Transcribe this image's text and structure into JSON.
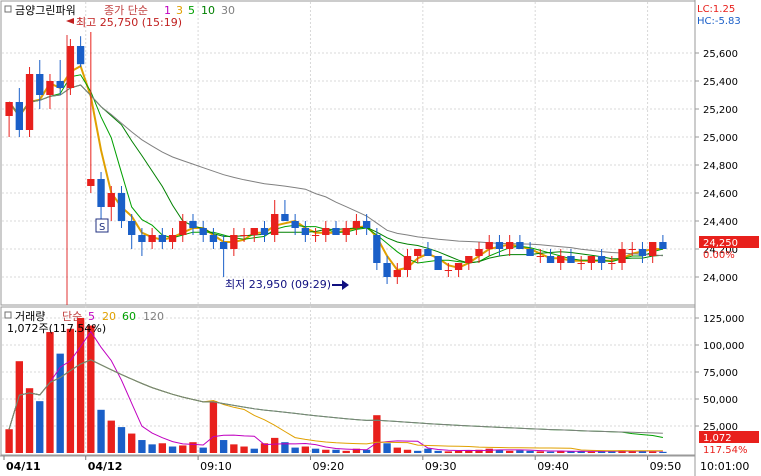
{
  "header": {
    "stock_name": "금양그린파워",
    "price_legend": "종가 단순",
    "ma_periods": [
      "1",
      "3",
      "5",
      "10",
      "30"
    ],
    "ma_colors": [
      "#c000c0",
      "#e0a000",
      "#00a000",
      "#008000",
      "#808080"
    ],
    "lc": "LC:1.25",
    "hc": "HC:-5.83"
  },
  "annotations": {
    "high": "최고 25,750 (15:19)",
    "low": "최저 23,950 (09:29)",
    "marker": "S"
  },
  "volume_header": {
    "title": "거래량",
    "ma_label": "단순",
    "ma_periods": [
      "5",
      "20",
      "60",
      "120"
    ],
    "ma_colors": [
      "#c000c0",
      "#e0a000",
      "#00a000",
      "#808080"
    ],
    "info": "1,072주(117.54%)"
  },
  "badges": {
    "price": "24,250",
    "price_pct": "0.00%",
    "volume": "1,072",
    "volume_pct": "117.54%"
  },
  "colors": {
    "up": "#e8201c",
    "down": "#1a5fc8",
    "badge": "#e8201c",
    "grid": "#d8d8d8"
  },
  "chart_data": [
    {
      "type": "candlestick",
      "x_labels": [
        "04/11",
        "04/12",
        "09:10",
        "09:20",
        "09:30",
        "09:40",
        "09:50",
        "10:01:00"
      ],
      "ylim": [
        23850,
        25750
      ],
      "yticks": [
        24000,
        24200,
        24400,
        24600,
        24800,
        25000,
        25200,
        25400,
        25600
      ],
      "ohlc": [
        [
          25150,
          25250,
          25000,
          25250
        ],
        [
          25250,
          25350,
          25000,
          25050
        ],
        [
          25050,
          25500,
          25000,
          25450
        ],
        [
          25450,
          25550,
          25200,
          25300
        ],
        [
          25300,
          25450,
          25200,
          25400
        ],
        [
          25400,
          25550,
          25300,
          25350
        ],
        [
          25350,
          25700,
          25300,
          25650
        ],
        [
          25650,
          25720,
          25500,
          25520
        ],
        [
          24650,
          25750,
          24600,
          24700
        ],
        [
          24700,
          24750,
          24400,
          24500
        ],
        [
          24500,
          24650,
          24400,
          24600
        ],
        [
          24600,
          24650,
          24350,
          24400
        ],
        [
          24400,
          24450,
          24200,
          24300
        ],
        [
          24300,
          24350,
          24150,
          24250
        ],
        [
          24250,
          24350,
          24200,
          24300
        ],
        [
          24300,
          24350,
          24200,
          24250
        ],
        [
          24250,
          24350,
          24200,
          24300
        ],
        [
          24300,
          24450,
          24250,
          24400
        ],
        [
          24400,
          24450,
          24300,
          24350
        ],
        [
          24350,
          24400,
          24250,
          24300
        ],
        [
          24300,
          24350,
          24200,
          24250
        ],
        [
          24250,
          24300,
          24000,
          24200
        ],
        [
          24200,
          24350,
          24150,
          24300
        ],
        [
          24300,
          24350,
          24250,
          24300
        ],
        [
          24300,
          24350,
          24250,
          24350
        ],
        [
          24350,
          24400,
          24250,
          24300
        ],
        [
          24300,
          24550,
          24250,
          24450
        ],
        [
          24450,
          24550,
          24400,
          24400
        ],
        [
          24400,
          24450,
          24300,
          24350
        ],
        [
          24350,
          24400,
          24250,
          24300
        ],
        [
          24300,
          24350,
          24250,
          24300
        ],
        [
          24300,
          24400,
          24250,
          24350
        ],
        [
          24350,
          24400,
          24300,
          24300
        ],
        [
          24300,
          24400,
          24250,
          24350
        ],
        [
          24350,
          24450,
          24300,
          24400
        ],
        [
          24400,
          24450,
          24300,
          24350
        ],
        [
          24300,
          24350,
          24050,
          24100
        ],
        [
          24100,
          24150,
          23950,
          24000
        ],
        [
          24000,
          24100,
          23950,
          24050
        ],
        [
          24050,
          24200,
          24000,
          24150
        ],
        [
          24150,
          24200,
          24100,
          24200
        ],
        [
          24200,
          24250,
          24150,
          24150
        ],
        [
          24150,
          24150,
          24050,
          24050
        ],
        [
          24050,
          24100,
          24000,
          24050
        ],
        [
          24050,
          24100,
          24000,
          24100
        ],
        [
          24100,
          24150,
          24050,
          24150
        ],
        [
          24150,
          24250,
          24100,
          24200
        ],
        [
          24200,
          24300,
          24150,
          24250
        ],
        [
          24250,
          24300,
          24150,
          24200
        ],
        [
          24200,
          24300,
          24150,
          24250
        ],
        [
          24250,
          24300,
          24200,
          24200
        ],
        [
          24200,
          24250,
          24150,
          24150
        ],
        [
          24150,
          24200,
          24100,
          24150
        ],
        [
          24150,
          24200,
          24100,
          24100
        ],
        [
          24100,
          24200,
          24050,
          24150
        ],
        [
          24150,
          24200,
          24100,
          24100
        ],
        [
          24100,
          24150,
          24050,
          24100
        ],
        [
          24100,
          24150,
          24050,
          24150
        ],
        [
          24150,
          24200,
          24050,
          24100
        ],
        [
          24100,
          24150,
          24050,
          24100
        ],
        [
          24100,
          24250,
          24050,
          24200
        ],
        [
          24200,
          24250,
          24150,
          24200
        ],
        [
          24200,
          24250,
          24100,
          24150
        ],
        [
          24150,
          24250,
          24100,
          24250
        ],
        [
          24250,
          24300,
          24200,
          24200
        ]
      ]
    },
    {
      "type": "bar",
      "ylim": [
        0,
        125000
      ],
      "yticks": [
        25000,
        50000,
        75000,
        100000,
        125000
      ],
      "values": [
        22000,
        85000,
        60000,
        48000,
        112000,
        92000,
        115000,
        125000,
        118000,
        40000,
        30000,
        24000,
        18000,
        12000,
        8000,
        9000,
        6000,
        7000,
        10000,
        5000,
        48000,
        12000,
        8000,
        6000,
        4000,
        9000,
        14000,
        10000,
        5000,
        6000,
        4000,
        3000,
        3000,
        2000,
        4000,
        3000,
        35000,
        9000,
        5000,
        3000,
        2000,
        4000,
        2000,
        1500,
        2000,
        2500,
        3000,
        4000,
        3000,
        2000,
        2500,
        2000,
        1500,
        1200,
        2000,
        1500,
        1800,
        1200,
        1500,
        2000,
        2500,
        1800,
        1500,
        1300,
        1072
      ],
      "up": [
        1,
        1,
        1,
        0,
        1,
        0,
        1,
        1,
        1,
        0,
        1,
        0,
        1,
        0,
        0,
        1,
        0,
        1,
        1,
        0,
        1,
        0,
        1,
        1,
        0,
        1,
        1,
        0,
        0,
        1,
        0,
        1,
        0,
        1,
        1,
        0,
        1,
        0,
        1,
        1,
        0,
        0,
        0,
        1,
        1,
        1,
        1,
        1,
        0,
        1,
        0,
        0,
        1,
        0,
        1,
        0,
        0,
        1,
        0,
        0,
        1,
        1,
        0,
        1,
        0
      ]
    }
  ]
}
